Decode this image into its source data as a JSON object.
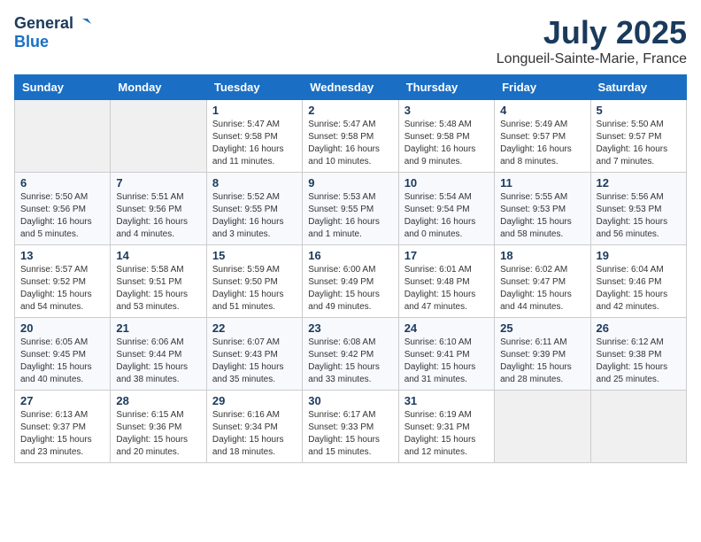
{
  "header": {
    "logo_general": "General",
    "logo_blue": "Blue",
    "month_year": "July 2025",
    "location": "Longueil-Sainte-Marie, France"
  },
  "weekdays": [
    "Sunday",
    "Monday",
    "Tuesday",
    "Wednesday",
    "Thursday",
    "Friday",
    "Saturday"
  ],
  "weeks": [
    [
      {
        "day": null
      },
      {
        "day": null
      },
      {
        "day": "1",
        "sunrise": "Sunrise: 5:47 AM",
        "sunset": "Sunset: 9:58 PM",
        "daylight": "Daylight: 16 hours and 11 minutes."
      },
      {
        "day": "2",
        "sunrise": "Sunrise: 5:47 AM",
        "sunset": "Sunset: 9:58 PM",
        "daylight": "Daylight: 16 hours and 10 minutes."
      },
      {
        "day": "3",
        "sunrise": "Sunrise: 5:48 AM",
        "sunset": "Sunset: 9:58 PM",
        "daylight": "Daylight: 16 hours and 9 minutes."
      },
      {
        "day": "4",
        "sunrise": "Sunrise: 5:49 AM",
        "sunset": "Sunset: 9:57 PM",
        "daylight": "Daylight: 16 hours and 8 minutes."
      },
      {
        "day": "5",
        "sunrise": "Sunrise: 5:50 AM",
        "sunset": "Sunset: 9:57 PM",
        "daylight": "Daylight: 16 hours and 7 minutes."
      }
    ],
    [
      {
        "day": "6",
        "sunrise": "Sunrise: 5:50 AM",
        "sunset": "Sunset: 9:56 PM",
        "daylight": "Daylight: 16 hours and 5 minutes."
      },
      {
        "day": "7",
        "sunrise": "Sunrise: 5:51 AM",
        "sunset": "Sunset: 9:56 PM",
        "daylight": "Daylight: 16 hours and 4 minutes."
      },
      {
        "day": "8",
        "sunrise": "Sunrise: 5:52 AM",
        "sunset": "Sunset: 9:55 PM",
        "daylight": "Daylight: 16 hours and 3 minutes."
      },
      {
        "day": "9",
        "sunrise": "Sunrise: 5:53 AM",
        "sunset": "Sunset: 9:55 PM",
        "daylight": "Daylight: 16 hours and 1 minute."
      },
      {
        "day": "10",
        "sunrise": "Sunrise: 5:54 AM",
        "sunset": "Sunset: 9:54 PM",
        "daylight": "Daylight: 16 hours and 0 minutes."
      },
      {
        "day": "11",
        "sunrise": "Sunrise: 5:55 AM",
        "sunset": "Sunset: 9:53 PM",
        "daylight": "Daylight: 15 hours and 58 minutes."
      },
      {
        "day": "12",
        "sunrise": "Sunrise: 5:56 AM",
        "sunset": "Sunset: 9:53 PM",
        "daylight": "Daylight: 15 hours and 56 minutes."
      }
    ],
    [
      {
        "day": "13",
        "sunrise": "Sunrise: 5:57 AM",
        "sunset": "Sunset: 9:52 PM",
        "daylight": "Daylight: 15 hours and 54 minutes."
      },
      {
        "day": "14",
        "sunrise": "Sunrise: 5:58 AM",
        "sunset": "Sunset: 9:51 PM",
        "daylight": "Daylight: 15 hours and 53 minutes."
      },
      {
        "day": "15",
        "sunrise": "Sunrise: 5:59 AM",
        "sunset": "Sunset: 9:50 PM",
        "daylight": "Daylight: 15 hours and 51 minutes."
      },
      {
        "day": "16",
        "sunrise": "Sunrise: 6:00 AM",
        "sunset": "Sunset: 9:49 PM",
        "daylight": "Daylight: 15 hours and 49 minutes."
      },
      {
        "day": "17",
        "sunrise": "Sunrise: 6:01 AM",
        "sunset": "Sunset: 9:48 PM",
        "daylight": "Daylight: 15 hours and 47 minutes."
      },
      {
        "day": "18",
        "sunrise": "Sunrise: 6:02 AM",
        "sunset": "Sunset: 9:47 PM",
        "daylight": "Daylight: 15 hours and 44 minutes."
      },
      {
        "day": "19",
        "sunrise": "Sunrise: 6:04 AM",
        "sunset": "Sunset: 9:46 PM",
        "daylight": "Daylight: 15 hours and 42 minutes."
      }
    ],
    [
      {
        "day": "20",
        "sunrise": "Sunrise: 6:05 AM",
        "sunset": "Sunset: 9:45 PM",
        "daylight": "Daylight: 15 hours and 40 minutes."
      },
      {
        "day": "21",
        "sunrise": "Sunrise: 6:06 AM",
        "sunset": "Sunset: 9:44 PM",
        "daylight": "Daylight: 15 hours and 38 minutes."
      },
      {
        "day": "22",
        "sunrise": "Sunrise: 6:07 AM",
        "sunset": "Sunset: 9:43 PM",
        "daylight": "Daylight: 15 hours and 35 minutes."
      },
      {
        "day": "23",
        "sunrise": "Sunrise: 6:08 AM",
        "sunset": "Sunset: 9:42 PM",
        "daylight": "Daylight: 15 hours and 33 minutes."
      },
      {
        "day": "24",
        "sunrise": "Sunrise: 6:10 AM",
        "sunset": "Sunset: 9:41 PM",
        "daylight": "Daylight: 15 hours and 31 minutes."
      },
      {
        "day": "25",
        "sunrise": "Sunrise: 6:11 AM",
        "sunset": "Sunset: 9:39 PM",
        "daylight": "Daylight: 15 hours and 28 minutes."
      },
      {
        "day": "26",
        "sunrise": "Sunrise: 6:12 AM",
        "sunset": "Sunset: 9:38 PM",
        "daylight": "Daylight: 15 hours and 25 minutes."
      }
    ],
    [
      {
        "day": "27",
        "sunrise": "Sunrise: 6:13 AM",
        "sunset": "Sunset: 9:37 PM",
        "daylight": "Daylight: 15 hours and 23 minutes."
      },
      {
        "day": "28",
        "sunrise": "Sunrise: 6:15 AM",
        "sunset": "Sunset: 9:36 PM",
        "daylight": "Daylight: 15 hours and 20 minutes."
      },
      {
        "day": "29",
        "sunrise": "Sunrise: 6:16 AM",
        "sunset": "Sunset: 9:34 PM",
        "daylight": "Daylight: 15 hours and 18 minutes."
      },
      {
        "day": "30",
        "sunrise": "Sunrise: 6:17 AM",
        "sunset": "Sunset: 9:33 PM",
        "daylight": "Daylight: 15 hours and 15 minutes."
      },
      {
        "day": "31",
        "sunrise": "Sunrise: 6:19 AM",
        "sunset": "Sunset: 9:31 PM",
        "daylight": "Daylight: 15 hours and 12 minutes."
      },
      {
        "day": null
      },
      {
        "day": null
      }
    ]
  ]
}
